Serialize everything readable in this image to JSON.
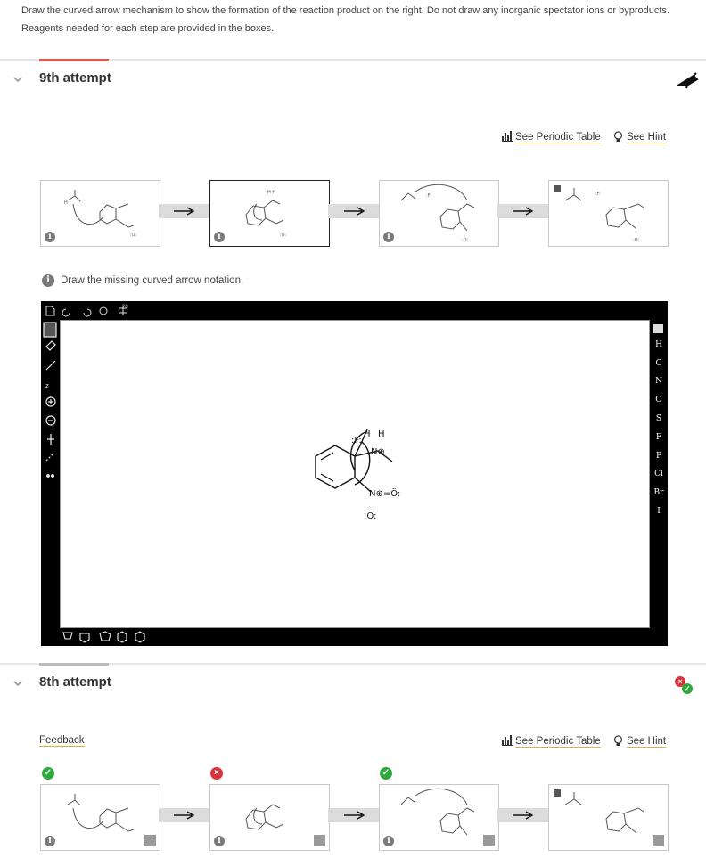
{
  "instructions": "Draw the curved arrow mechanism to show the formation of the reaction product on the right. Do not draw any inorganic spectator ions or byproducts. Reagents needed for each step are provided in the boxes.",
  "current": {
    "title": "9th attempt",
    "see_periodic_table": "See Periodic Table",
    "see_hint": "See Hint",
    "message": "Draw the missing curved arrow notation."
  },
  "editor": {
    "elements": [
      "H",
      "C",
      "N",
      "O",
      "S",
      "F",
      "P",
      "Cl",
      "Br",
      "I"
    ],
    "ring_label": "20"
  },
  "previous": {
    "title": "8th attempt",
    "feedback": "Feedback",
    "see_periodic_table": "See Periodic Table",
    "see_hint": "See Hint"
  },
  "colors": {
    "accent": "#e05a4e",
    "link_underline": "#e3b23c",
    "ok": "#2eaa3c",
    "bad": "#d9343b"
  }
}
